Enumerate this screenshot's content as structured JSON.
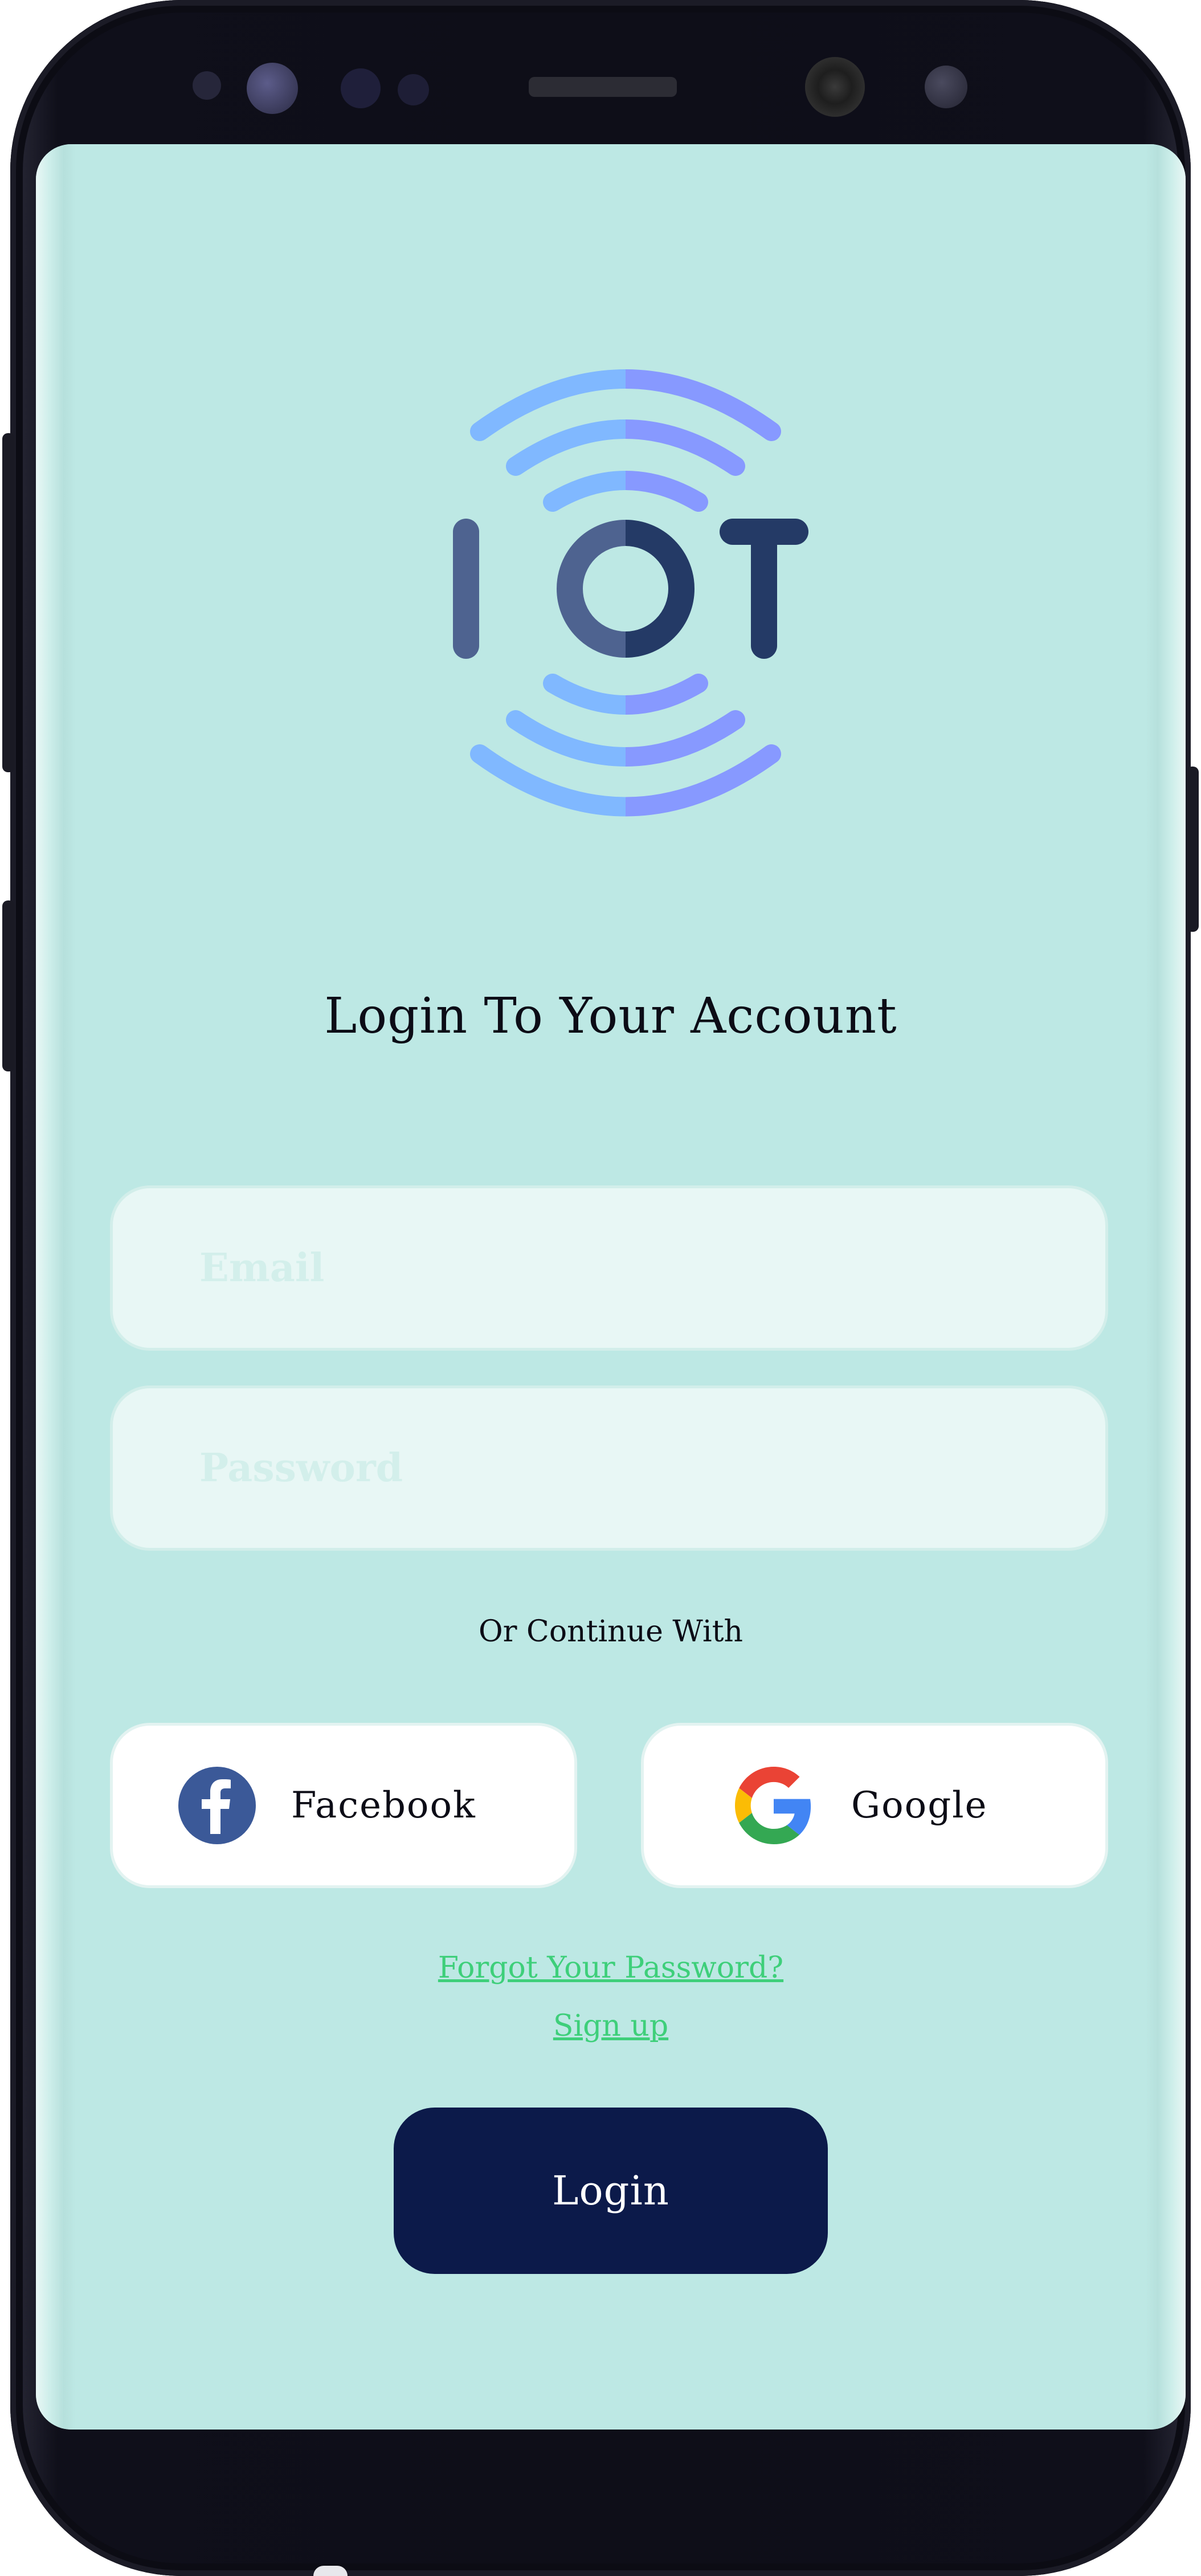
{
  "screen": {
    "title": "Login To Your Account",
    "email_placeholder": "Email",
    "password_placeholder": "Password",
    "or_continue": "Or Continue With",
    "facebook_label": "Facebook",
    "google_label": "Google",
    "forgot_link": "Forgot Your Password?",
    "signup_link": "Sign up",
    "login_button": "Login"
  },
  "logo": {
    "letters": [
      "I",
      "O",
      "T"
    ]
  },
  "colors": {
    "screen_bg": "#bde8e4",
    "primary_button": "#0c1a4a",
    "link": "#3ecf7a",
    "logo_light_blue": "#80b8ff",
    "logo_violet": "#8799ff",
    "logo_dark": "#243a66",
    "facebook_blue": "#3b5998"
  },
  "icons": [
    "facebook-icon",
    "google-icon"
  ]
}
